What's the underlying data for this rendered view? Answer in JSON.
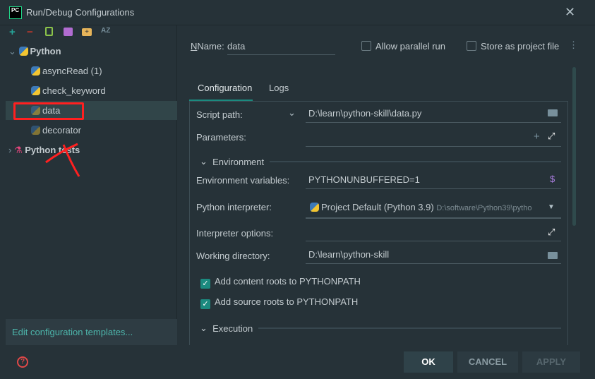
{
  "window": {
    "title": "Run/Debug Configurations",
    "logo": "PC"
  },
  "toolbar": {
    "icons": [
      "plus-icon",
      "minus-icon",
      "copy-icon",
      "save-icon",
      "folder-add-icon",
      "sort-alpha-icon"
    ],
    "sort_label": "AZ"
  },
  "tree": {
    "group": "Python",
    "items": [
      {
        "label": "asyncRead (1)"
      },
      {
        "label": "check_keyword"
      },
      {
        "label": "data"
      },
      {
        "label": "decorator"
      }
    ],
    "group2": "Python tests"
  },
  "templates_link": "Edit configuration templates...",
  "name": {
    "label": "Name:",
    "value": "data"
  },
  "options": {
    "parallel": "Allow parallel run",
    "store": "Store as project file"
  },
  "tabs": [
    {
      "label": "Configuration",
      "active": true
    },
    {
      "label": "Logs"
    }
  ],
  "form": {
    "script_label": "Script path:",
    "script_value": "D:\\learn\\python-skill\\data.py",
    "params_label": "Parameters:",
    "env_section": "Environment",
    "envvars_label": "Environment variables:",
    "envvars_value": "PYTHONUNBUFFERED=1",
    "interp_label": "Python interpreter:",
    "interp_value": "Project Default (Python 3.9)",
    "interp_path": "D:\\software\\Python39\\pytho",
    "interp_opts_label": "Interpreter options:",
    "workdir_label": "Working directory:",
    "workdir_value": "D:\\learn\\python-skill",
    "content_roots": "Add content roots to PYTHONPATH",
    "source_roots": "Add source roots to PYTHONPATH",
    "exec_section": "Execution"
  },
  "buttons": {
    "ok": "OK",
    "cancel": "CANCEL",
    "apply": "APPLY"
  },
  "colors": {
    "bg": "#263238",
    "accent": "#1b8a7f",
    "selection": "#314549",
    "annotation": "#ff2020"
  }
}
